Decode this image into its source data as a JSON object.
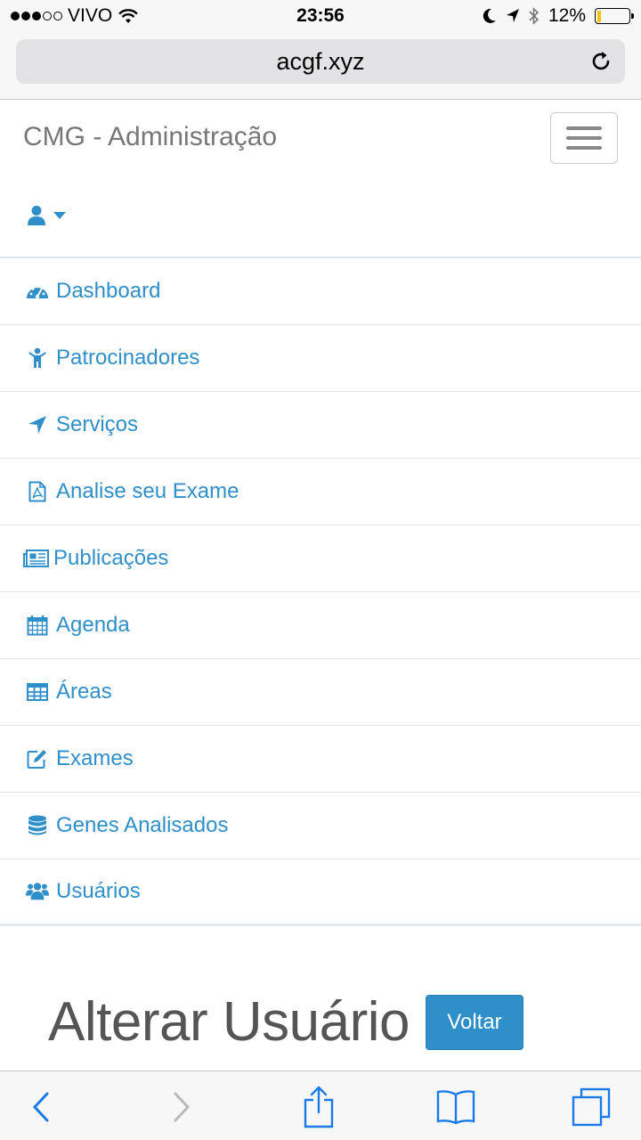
{
  "status_bar": {
    "carrier": "VIVO",
    "time": "23:56",
    "battery_percent": "12%",
    "battery_level": 0.12
  },
  "browser": {
    "url": "acgf.xyz"
  },
  "navbar": {
    "brand": "CMG - Administração"
  },
  "menu": {
    "items": [
      {
        "label": "Dashboard",
        "icon": "dashboard-icon"
      },
      {
        "label": "Patrocinadores",
        "icon": "child-icon"
      },
      {
        "label": "Serviços",
        "icon": "location-arrow-icon"
      },
      {
        "label": "Analise seu Exame",
        "icon": "file-pdf-icon"
      },
      {
        "label": "Publicações",
        "icon": "newspaper-icon"
      },
      {
        "label": "Agenda",
        "icon": "calendar-icon"
      },
      {
        "label": "Áreas",
        "icon": "table-icon"
      },
      {
        "label": "Exames",
        "icon": "edit-icon"
      },
      {
        "label": "Genes Analisados",
        "icon": "database-icon"
      },
      {
        "label": "Usuários",
        "icon": "users-icon"
      }
    ]
  },
  "content": {
    "title": "Alterar Usuário",
    "back_button": "Voltar"
  },
  "colors": {
    "link": "#2f8fc9",
    "button": "#2f8fc9",
    "toolbar_icon": "#1a7ae8"
  }
}
